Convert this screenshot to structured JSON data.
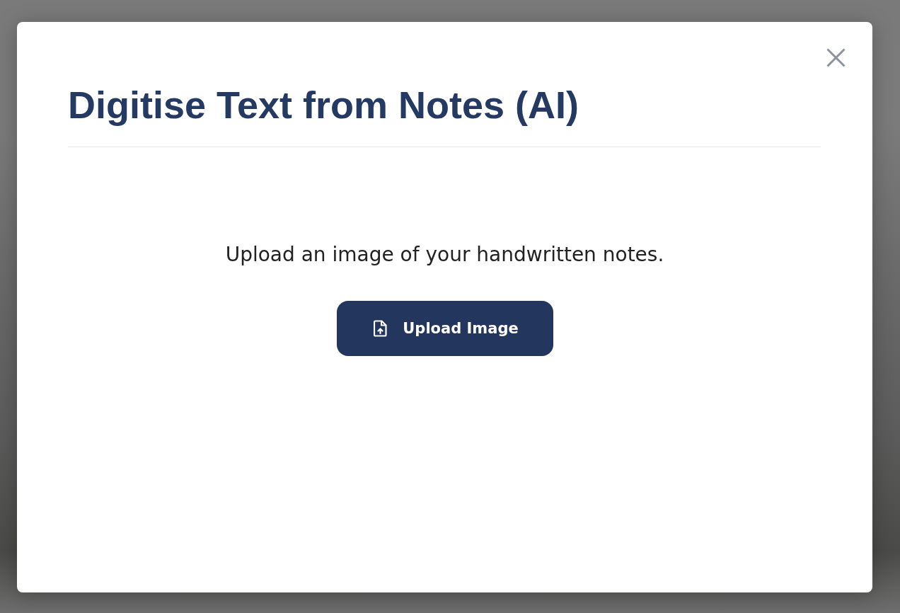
{
  "dialog": {
    "title": "Digitise Text from Notes (AI)",
    "message": "Upload an image of your handwritten notes.",
    "upload_button": {
      "label": "Upload Image"
    }
  }
}
